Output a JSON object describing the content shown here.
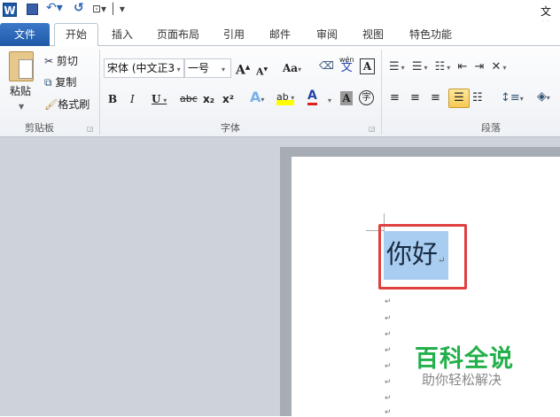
{
  "quick_access": {
    "app_icon": "word-icon",
    "save": "save-icon",
    "undo": "undo-icon",
    "redo": "redo-icon",
    "customize": "customize-icon",
    "title_partial": "文档"
  },
  "tabs": [
    {
      "label": "文件"
    },
    {
      "label": "开始"
    },
    {
      "label": "插入"
    },
    {
      "label": "页面布局"
    },
    {
      "label": "引用"
    },
    {
      "label": "邮件"
    },
    {
      "label": "审阅"
    },
    {
      "label": "视图"
    },
    {
      "label": "特色功能"
    }
  ],
  "clipboard": {
    "paste": "粘贴",
    "cut": "剪切",
    "copy": "复制",
    "format_painter": "格式刷",
    "group": "剪贴板"
  },
  "font": {
    "name": "宋体 (中文正3",
    "size": "一号",
    "group": "字体",
    "bold": "B",
    "italic": "I",
    "underline": "U",
    "strike": "abc",
    "sub": "x₂",
    "sup": "x²",
    "grow": "A",
    "shrink": "A",
    "case": "Aa",
    "pinyin_top": "wén",
    "pinyin": "文",
    "border_char": "A",
    "shade": "A",
    "enclose": "字",
    "color_a": "A",
    "effects": "A",
    "highlight": "ab",
    "clear": "A"
  },
  "paragraph": {
    "group": "段落"
  },
  "colors": {
    "accent": "#2a64b4",
    "font_color": "#e02020",
    "highlight": "#ffff00",
    "selection": "#a8cdf0",
    "annotation": "#e04040",
    "watermark_green": "#22b04a"
  },
  "document": {
    "text": "你好",
    "mark": "↵",
    "empty_paragraphs": [
      "↵",
      "↵",
      "↵",
      "↵",
      "↵",
      "↵",
      "↵",
      "↵",
      "↵"
    ]
  },
  "watermark": {
    "title": "百科全说",
    "subtitle": "助你轻松解决"
  }
}
